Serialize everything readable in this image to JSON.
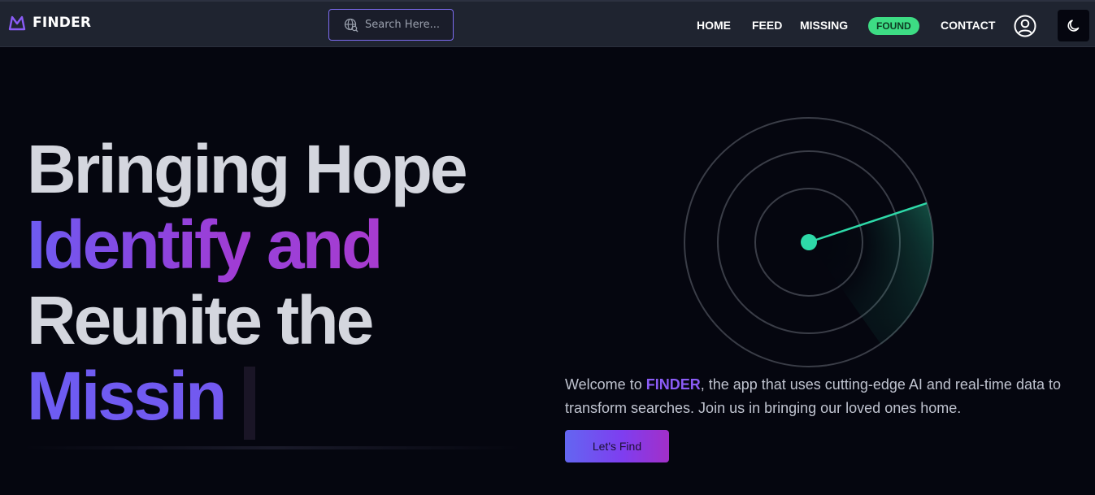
{
  "navbar": {
    "brand_name": "FINDER",
    "search": {
      "placeholder": "Search Here...",
      "value": ""
    },
    "links": [
      "HOME",
      "FEED",
      "MISSING",
      "FOUND",
      "CONTACT"
    ],
    "active_link": "FOUND",
    "icons": {
      "logo": "finder-logo-icon",
      "search": "globe-search-icon",
      "user": "user-circle-icon",
      "theme": "moon-icon"
    }
  },
  "hero": {
    "headline": {
      "line1": "Bringing Hope",
      "line2_word1": "Identify",
      "line2_word2": "and",
      "line3": "Reunite the",
      "line4": "Missin"
    },
    "intro": {
      "prefix": "Welcome to ",
      "brand": "FINDER",
      "suffix": ", the app that uses cutting-edge AI and real-time data to transform searches. Join us in bringing our loved ones home."
    },
    "cta_label": "Let's Find"
  },
  "colors": {
    "nav_bg": "#1f2430",
    "page_bg": "#05060f",
    "accent_purple": "#8b5cf6",
    "accent_green": "#3ddc84",
    "radar_teal": "#2ed9a8",
    "headline_white": "#d4d6de"
  }
}
